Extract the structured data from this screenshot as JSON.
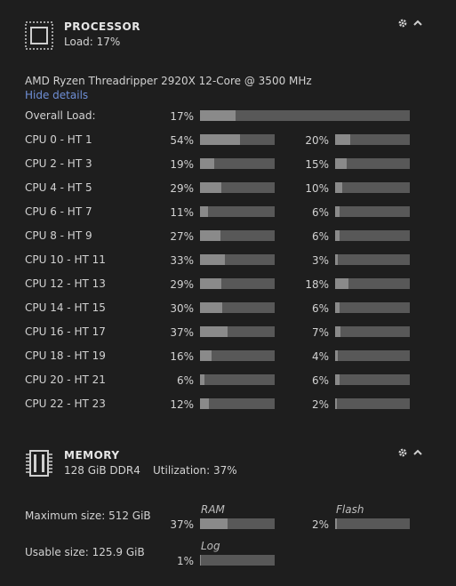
{
  "processor": {
    "title": "PROCESSOR",
    "load_text": "Load: 17%",
    "model": "AMD Ryzen Threadripper 2920X 12-Core @ 3500 MHz",
    "toggle_details": "Hide details",
    "overall": {
      "label": "Overall Load:",
      "pct_text": "17%",
      "value": 0.17
    },
    "rows": [
      {
        "label": "CPU 0 - HT 1",
        "a_text": "54%",
        "a": 0.54,
        "b_text": "20%",
        "b": 0.2
      },
      {
        "label": "CPU 2 - HT 3",
        "a_text": "19%",
        "a": 0.19,
        "b_text": "15%",
        "b": 0.15
      },
      {
        "label": "CPU 4 - HT 5",
        "a_text": "29%",
        "a": 0.29,
        "b_text": "10%",
        "b": 0.1
      },
      {
        "label": "CPU 6 - HT 7",
        "a_text": "11%",
        "a": 0.11,
        "b_text": "6%",
        "b": 0.06
      },
      {
        "label": "CPU 8 - HT 9",
        "a_text": "27%",
        "a": 0.27,
        "b_text": "6%",
        "b": 0.06
      },
      {
        "label": "CPU 10 - HT 11",
        "a_text": "33%",
        "a": 0.33,
        "b_text": "3%",
        "b": 0.03
      },
      {
        "label": "CPU 12 - HT 13",
        "a_text": "29%",
        "a": 0.29,
        "b_text": "18%",
        "b": 0.18
      },
      {
        "label": "CPU 14 - HT 15",
        "a_text": "30%",
        "a": 0.3,
        "b_text": "6%",
        "b": 0.06
      },
      {
        "label": "CPU 16 - HT 17",
        "a_text": "37%",
        "a": 0.37,
        "b_text": "7%",
        "b": 0.07
      },
      {
        "label": "CPU 18 - HT 19",
        "a_text": "16%",
        "a": 0.16,
        "b_text": "4%",
        "b": 0.04
      },
      {
        "label": "CPU 20 - HT 21",
        "a_text": "6%",
        "a": 0.06,
        "b_text": "6%",
        "b": 0.06
      },
      {
        "label": "CPU 22 - HT 23",
        "a_text": "12%",
        "a": 0.12,
        "b_text": "2%",
        "b": 0.02
      }
    ]
  },
  "memory": {
    "title": "MEMORY",
    "capacity": "128 GiB DDR4",
    "utilization": "Utilization: 37%",
    "max_size": "Maximum size: 512 GiB",
    "usable_size": "Usable size: 125.9 GiB",
    "ram": {
      "label": "RAM",
      "pct_text": "37%",
      "value": 0.37
    },
    "flash": {
      "label": "Flash",
      "pct_text": "2%",
      "value": 0.02
    },
    "log": {
      "label": "Log",
      "pct_text": "1%",
      "value": 0.01
    }
  },
  "icons": {
    "cpu": "cpu-chip-icon",
    "memory": "memory-module-icon",
    "settings": "gear-icon",
    "collapse": "chevron-up-icon"
  }
}
